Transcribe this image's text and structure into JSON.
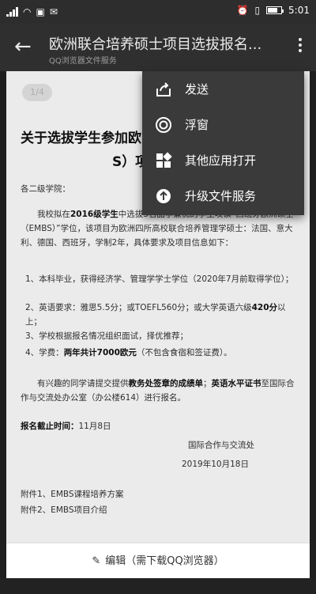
{
  "status_bar": {
    "time": "5:01",
    "left_icons": [
      "signal-icon",
      "wifi-icon",
      "notification-icon",
      "message-icon"
    ],
    "right_icons": [
      "alarm-icon",
      "vibrate-icon",
      "battery-icon"
    ]
  },
  "appbar": {
    "title": "欧洲联合培养硕士项目选拔报名...",
    "subtitle": "QQ浏览器文件服务"
  },
  "menu": {
    "items": [
      {
        "label": "发送",
        "icon": "share-icon"
      },
      {
        "label": "浮窗",
        "icon": "float-window-icon"
      },
      {
        "label": "其他应用打开",
        "icon": "apps-icon"
      },
      {
        "label": "升级文件服务",
        "icon": "upgrade-icon"
      }
    ]
  },
  "document": {
    "page_badge": "1/4",
    "title_line1": "关于选拔学生参加欧",
    "title_line2": "S）项",
    "greeting": "各二级学院：",
    "para1_prefix": "我校拟在",
    "para1_bold": "2016级学生",
    "para1_rest": "中选拔5名品学兼优的学生攻读“西班牙欧洲硕士（EMBS）”学位，该项目为欧洲四所高校联合培养管理学硕士：法国、意大利、德国、西班牙，学制2年，具体要求及项目信息如下：",
    "item1": "1、本科毕业，获得经济学、管理学学士学位（2020年7月前取得学位）；",
    "item2_prefix": "2、英语要求：雅思5.5分；或TOEFL560分；或大学英语六级",
    "item2_bold": "420分",
    "item2_suffix": "以上；",
    "item3": "3、学校根据报名情况组织面试，择优推荐；",
    "item4_prefix": "4、学费：",
    "item4_bold": "两年共计7000欧元",
    "item4_suffix": "（不包含食宿和签证费）。",
    "para2_prefix": "有兴趣的同学请提交提供",
    "para2_bold1": "教务处签章的成绩单",
    "para2_mid": "；",
    "para2_bold2": "英语水平证书",
    "para2_rest": "至国际合作与交流处办公室（办公楼614）进行报名。",
    "deadline_label": "报名截止时间：",
    "deadline_value": "11月8日",
    "signature": "国际合作与交流处",
    "date": "2019年10月18日",
    "attachment1": "附件1、EMBS课程培养方案",
    "attachment2": "附件2、EMBS项目介绍"
  },
  "bottom_bar": {
    "edit_label": "编辑（需下载QQ浏览器）"
  }
}
